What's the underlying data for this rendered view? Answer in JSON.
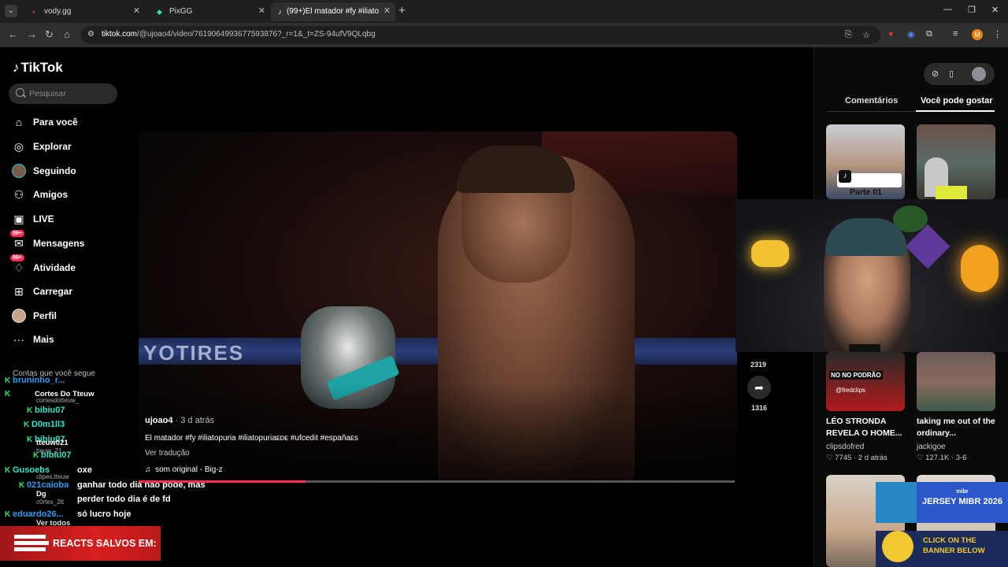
{
  "browser": {
    "tabs": [
      {
        "title": "vody.gg",
        "icon": "vody-icon",
        "active": false
      },
      {
        "title": "PixGG",
        "icon": "pixgg-icon",
        "active": false
      },
      {
        "title": "(99+)El matador #fy #iliato",
        "icon": "tiktok-icon",
        "active": true
      }
    ],
    "url_host": "tiktok.com",
    "url_path": "/@ujoao4/video/7619064993677593876?_r=1&_t=ZS-94ufV9QLqbg",
    "profile_initial": "M"
  },
  "sidebar": {
    "brand": "TikTok",
    "search_placeholder": "Pesquisar",
    "items": [
      {
        "label": "Para você",
        "icon": "home-icon"
      },
      {
        "label": "Explorar",
        "icon": "compass-icon"
      },
      {
        "label": "Seguindo",
        "icon": "following-avatar-icon"
      },
      {
        "label": "Amigos",
        "icon": "friends-icon"
      },
      {
        "label": "LIVE",
        "icon": "live-icon"
      },
      {
        "label": "Mensagens",
        "icon": "messages-icon",
        "badge": "99+"
      },
      {
        "label": "Atividade",
        "icon": "activity-icon",
        "badge": "99+"
      },
      {
        "label": "Carregar",
        "icon": "upload-icon"
      },
      {
        "label": "Perfil",
        "icon": "profile-avatar-icon"
      },
      {
        "label": "Mais",
        "icon": "more-icon"
      }
    ],
    "following_label": "Contas que você segue",
    "see_all": "Ver todos"
  },
  "chat": {
    "names": [
      "bruninho_r...",
      "Cortes Do Tteuw",
      "cortesdotteuw_",
      "bibiu07",
      "D0m1ll3",
      "bibiu07",
      "tteuw021",
      "tteuw_21",
      "bibiu07",
      "Gusoebs",
      "clipes.tteuw",
      "oxe",
      "021caioba",
      "Dg",
      "c0rtes_2tt",
      "eduardo26..."
    ],
    "messages": [
      "ganhar todo dia não pode, mas",
      "perder todo dia é de fd",
      "só lucro hoje"
    ],
    "banner": "REACTS SALVOS EM:"
  },
  "video": {
    "author": "ujoao4",
    "time_ago": "· 3 d atrás",
    "caption": "El matador #fy #iliatopuria #iliatopuriaᴇᴅᴇ #ufcedit #españaᴇs",
    "see_translation": "Ver tradução",
    "sound": "som original - Big-z",
    "ring_text": "YOTIRES",
    "progress": 0.28,
    "comment_count": "2319",
    "share_count": "1316"
  },
  "right_panel": {
    "tabs": [
      "Comentários",
      "Você pode gostar"
    ],
    "active_tab": 1,
    "cards": [
      {
        "overlay": "Parte 01"
      },
      {},
      {
        "overlay": "NO NO PODRÃO",
        "handle": "@fredclips",
        "title": "LÉO STRONDA REVELA O HOME...",
        "author": "clipsdofred",
        "likes": "7745",
        "age": "2 d atrás"
      },
      {
        "title": "taking me out of the ordinary...",
        "author": "jackigoe",
        "likes": "127.1K",
        "age": "3-6"
      }
    ]
  },
  "ad": {
    "brand": "mibr",
    "headline": "JERSEY MIBR 2026",
    "cta": "CLICK ON THE BANNER BELOW"
  },
  "colors": {
    "accent": "#fe2c55",
    "chat_badge": "#2ee66b",
    "banner": "#d81f1f"
  }
}
